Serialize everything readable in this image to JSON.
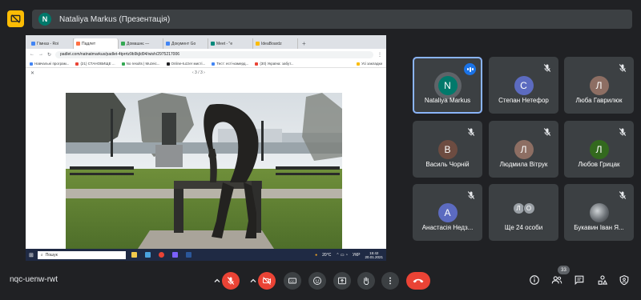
{
  "presenter_banner": {
    "avatar_letter": "N",
    "text": "Nataliya Markus (Презентація)"
  },
  "shared_screen": {
    "tabs": [
      {
        "label": "Гімназ - Roi",
        "color": "#4285f4"
      },
      {
        "label": "Падлет",
        "color": "#ff7043",
        "active": true
      },
      {
        "label": "Домашнє — ",
        "color": "#34a853"
      },
      {
        "label": "Документ Go",
        "color": "#4285f4"
      },
      {
        "label": "Meet - \"e",
        "color": "#00897b"
      },
      {
        "label": "IdeaBoardz",
        "color": "#fbbc04"
      }
    ],
    "url": "padlet.com/natnatmarkus/padlet-4tprrtz9b9kjld94/wish/2975217006",
    "bookmarks": [
      {
        "label": "Навчальні програм...",
        "color": "#4285f4"
      },
      {
        "label": "(21) СТАНОВИЩЕ ...",
        "color": "#ea4335"
      },
      {
        "label": "No results | Muzeic...",
        "color": "#34a853"
      },
      {
        "label": "Online-tuzzer мисті...",
        "color": "#202124"
      },
      {
        "label": "Тест: есті-камерд...",
        "color": "#4285f4"
      },
      {
        "label": "(30) Україна: забут...",
        "color": "#ea4335"
      },
      {
        "label": "Усі закладки",
        "color": "#fbbc04"
      }
    ],
    "viewer_nav": "‹  3 / 3  ›",
    "taskbar": {
      "search_placeholder": "Пошук",
      "temperature": "20°C",
      "language": "УКР",
      "time": "15:42",
      "date": "20.01.2021"
    }
  },
  "participants": [
    {
      "name": "Nataliya Markus",
      "letter": "N",
      "color": "#00796b",
      "speaking": true,
      "ring": true
    },
    {
      "name": "Степан Нетефор",
      "letter": "С",
      "color": "#5c6bc0"
    },
    {
      "name": "Люба Гаврилюк",
      "letter": "Л",
      "color": "#8d6e63"
    },
    {
      "name": "Василь Чорній",
      "letter": "В",
      "color": "#6d4c41"
    },
    {
      "name": "Людмила Вітрук",
      "letter": "Л",
      "color": "#8d6e63"
    },
    {
      "name": "Любов Грицак",
      "letter": "Л",
      "color": "#33691e"
    },
    {
      "name": "Анастасія Недз...",
      "letter": "А",
      "color": "#5c6bc0"
    },
    {
      "name": "Ще 24 особи",
      "letters": [
        "Л",
        "О"
      ]
    },
    {
      "name": "Букавин Іван Я...",
      "photo": true
    }
  ],
  "bottom_bar": {
    "meeting_code": "nqc-uenw-rwt",
    "participant_count": "33"
  },
  "icons": {
    "mic_off": "mic-off-icon",
    "cam_off": "videocam-off-icon",
    "captions": "captions-icon",
    "emoji": "emoji-icon",
    "present": "present-screen-icon",
    "hand": "raise-hand-icon",
    "more": "more-vert-icon",
    "hangup": "call-end-icon",
    "info": "info-icon",
    "people": "people-icon",
    "chat": "chat-icon",
    "activities": "activities-icon",
    "host": "host-controls-icon"
  },
  "colors": {
    "accent": "#8ab4f8",
    "danger": "#ea4335",
    "surface": "#3c4043",
    "background": "#202124",
    "present_badge": "#fbbc04"
  }
}
